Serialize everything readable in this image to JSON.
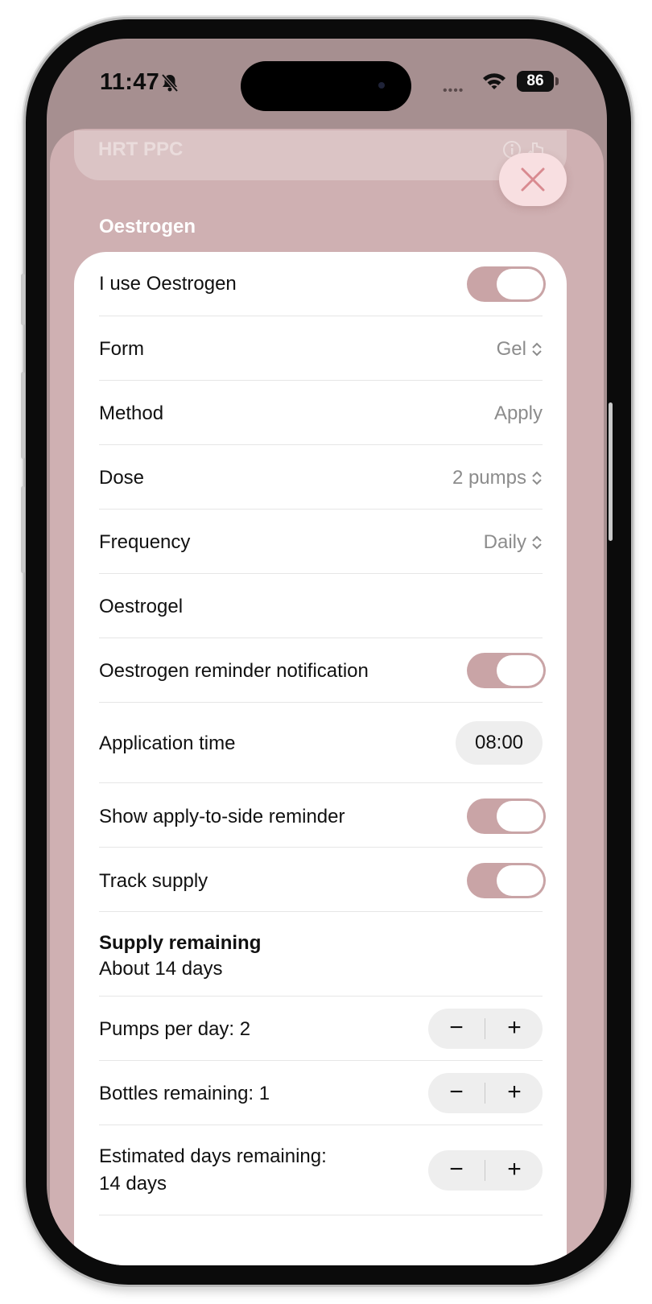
{
  "status_bar": {
    "time": "11:47",
    "battery": "86",
    "signal_dots": "••••"
  },
  "sheet": {
    "header_title": "HRT PPC",
    "section_title": "Oestrogen"
  },
  "rows": {
    "use": {
      "label": "I use Oestrogen",
      "on": true
    },
    "form": {
      "label": "Form",
      "value": "Gel"
    },
    "method": {
      "label": "Method",
      "value": "Apply"
    },
    "dose": {
      "label": "Dose",
      "value": "2 pumps"
    },
    "frequency": {
      "label": "Frequency",
      "value": "Daily"
    },
    "product": {
      "label": "Oestrogel"
    },
    "reminder": {
      "label": "Oestrogen reminder notification",
      "on": true
    },
    "application_time": {
      "label": "Application time",
      "value": "08:00"
    },
    "side_reminder": {
      "label": "Show apply-to-side reminder",
      "on": true
    },
    "track_supply": {
      "label": "Track supply",
      "on": true
    },
    "supply_remaining": {
      "label": "Supply remaining",
      "value": "About 14 days"
    },
    "pumps_per_day": {
      "label": "Pumps per day: 2",
      "minus": "−",
      "plus": "+"
    },
    "bottles_remaining": {
      "label": "Bottles remaining: 1",
      "minus": "−",
      "plus": "+"
    },
    "estimated_days": {
      "label_line1": "Estimated days remaining:",
      "label_line2": "14 days",
      "minus": "−",
      "plus": "+"
    }
  },
  "colors": {
    "sheet_bg": "#cfb0b2",
    "toggle_on": "#c9a4a6",
    "close_button": "#f8dfe1",
    "close_icon": "#d98a90"
  }
}
